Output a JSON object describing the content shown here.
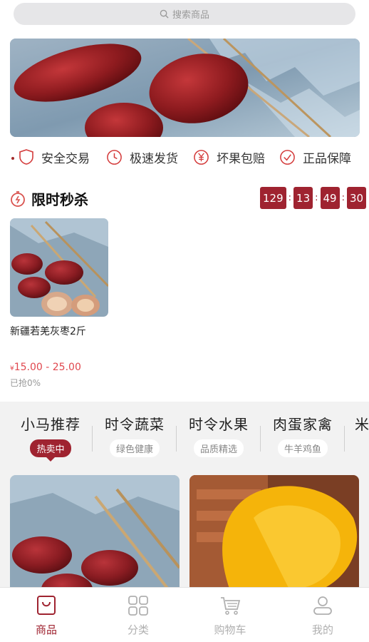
{
  "search": {
    "placeholder": "搜索商品"
  },
  "guarantees": [
    {
      "label": "安全交易",
      "icon": "shield-icon"
    },
    {
      "label": "极速发货",
      "icon": "clock-icon"
    },
    {
      "label": "坏果包赔",
      "icon": "yen-coin-icon"
    },
    {
      "label": "正品保障",
      "icon": "check-circle-icon"
    }
  ],
  "flash_sale": {
    "title": "限时秒杀",
    "countdown": {
      "hours": "129",
      "minutes": "13",
      "seconds": "49",
      "millis": "30"
    },
    "product": {
      "name": "新疆若羌灰枣2斤",
      "currency": "¥",
      "price": "15.00 - 25.00",
      "sold": "已抢0%"
    }
  },
  "categories": [
    {
      "title": "小马推荐",
      "sub": "热卖中",
      "active": true
    },
    {
      "title": "时令蔬菜",
      "sub": "绿色健康"
    },
    {
      "title": "时令水果",
      "sub": "品质精选"
    },
    {
      "title": "肉蛋家禽",
      "sub": "牛羊鸡鱼"
    },
    {
      "title": "米"
    }
  ],
  "tabbar": [
    {
      "label": "商品",
      "icon": "shop-bag-icon",
      "active": true
    },
    {
      "label": "分类",
      "icon": "grid-icon"
    },
    {
      "label": "购物车",
      "icon": "cart-icon"
    },
    {
      "label": "我的",
      "icon": "user-icon"
    }
  ],
  "colors": {
    "accent": "#9f2330",
    "price": "#e0474e"
  }
}
